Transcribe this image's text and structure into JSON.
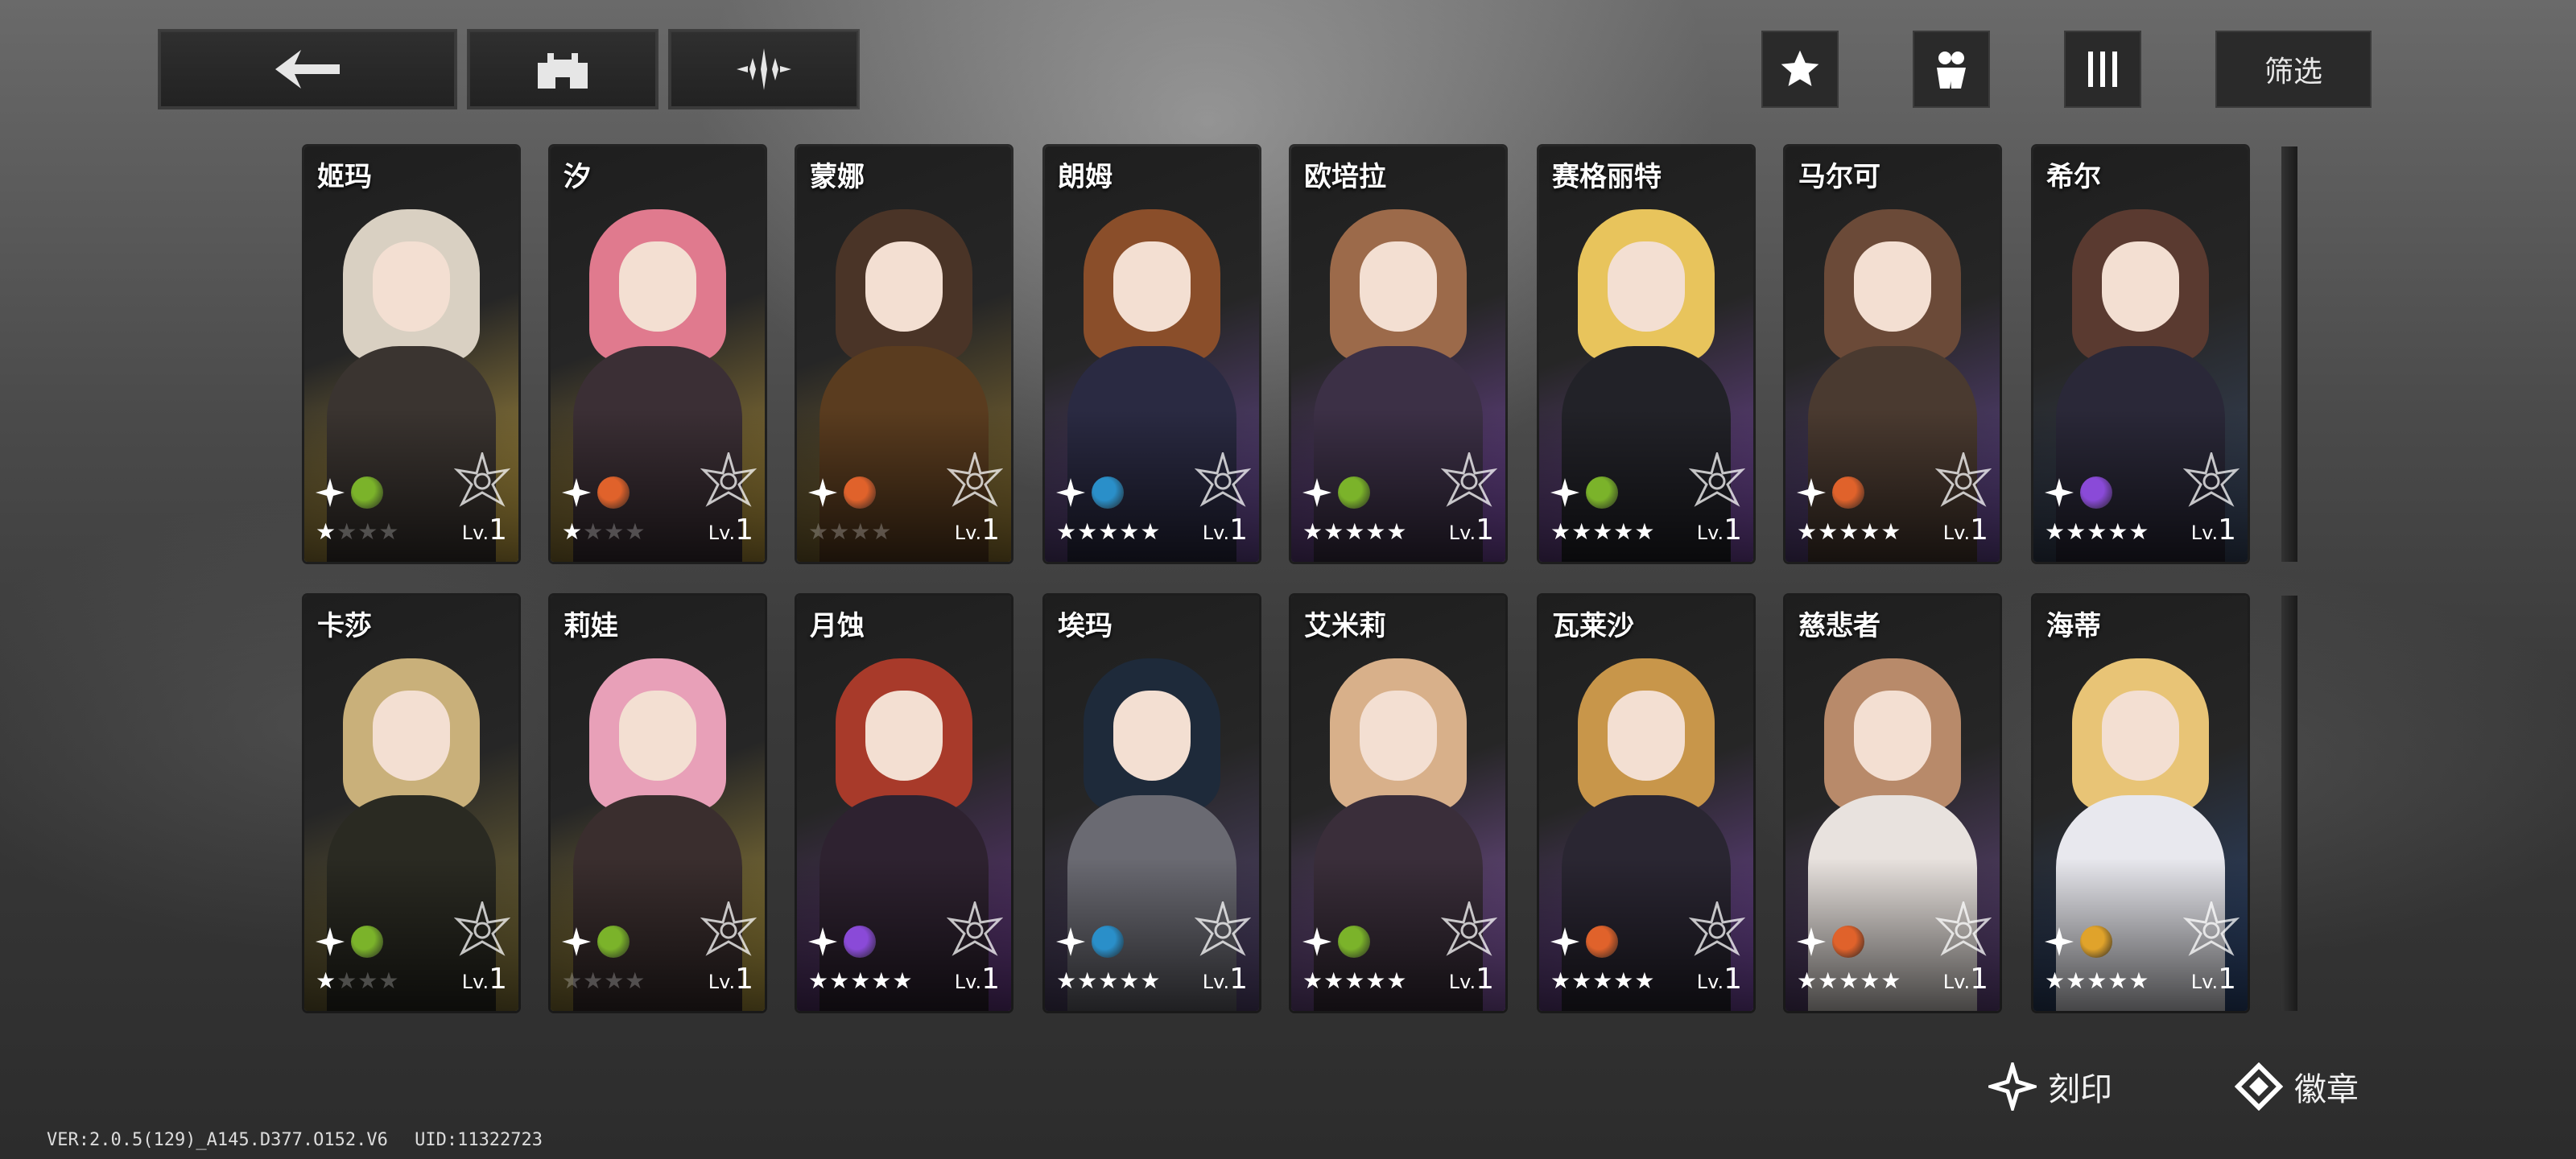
{
  "header": {
    "back_icon": "back-arrow-icon",
    "castle_icon": "castle-icon",
    "emblem_icon": "emblem-icon",
    "favorite_icon": "star-icon",
    "team_icon": "team-icon",
    "bars_icon": "bars-icon",
    "filter_label": "筛选"
  },
  "characters_row1": [
    {
      "name": "姬玛",
      "stars": "★",
      "stars_off": "★★★",
      "level_prefix": "Lv.",
      "level": "1",
      "element_color": "#7bb32a",
      "bg": "#c9a743",
      "hair": "#d9d0c2",
      "outfit": "#3a3430"
    },
    {
      "name": "汐",
      "stars": "★",
      "stars_off": "★★★",
      "level_prefix": "Lv.",
      "level": "1",
      "element_color": "#e0622b",
      "bg": "#b7963a",
      "hair": "#e07a8e",
      "outfit": "#3b2f35"
    },
    {
      "name": "蒙娜",
      "stars": "",
      "stars_off": "★★★★",
      "level_prefix": "Lv.",
      "level": "1",
      "element_color": "#e0622b",
      "bg": "#9a7d33",
      "hair": "#4a3427",
      "outfit": "#5a3c1f"
    },
    {
      "name": "朗姆",
      "stars": "★★★★★",
      "stars_off": "",
      "level_prefix": "Lv.",
      "level": "1",
      "element_color": "#2a8fc9",
      "bg": "#6a4a9a",
      "hair": "#8a4e2a",
      "outfit": "#2a2a42"
    },
    {
      "name": "欧培拉",
      "stars": "★★★★★",
      "stars_off": "",
      "level_prefix": "Lv.",
      "level": "1",
      "element_color": "#7bb32a",
      "bg": "#7a4aa8",
      "hair": "#9c6a4a",
      "outfit": "#3c3046"
    },
    {
      "name": "赛格丽特",
      "stars": "★★★★★",
      "stars_off": "",
      "level_prefix": "Lv.",
      "level": "1",
      "element_color": "#7bb32a",
      "bg": "#7a4aa8",
      "hair": "#e8c45c",
      "outfit": "#222228"
    },
    {
      "name": "马尔可",
      "stars": "★★★★★",
      "stars_off": "",
      "level_prefix": "Lv.",
      "level": "1",
      "element_color": "#e0622b",
      "bg": "#6a4a9a",
      "hair": "#6b4a38",
      "outfit": "#4a3a30"
    },
    {
      "name": "希尔",
      "stars": "★★★★★",
      "stars_off": "",
      "level_prefix": "Lv.",
      "level": "1",
      "element_color": "#8a4ad8",
      "bg": "#3a4a66",
      "hair": "#5a3a30",
      "outfit": "#2a2838"
    }
  ],
  "characters_row2": [
    {
      "name": "卡莎",
      "stars": "★",
      "stars_off": "★★★",
      "level_prefix": "Lv.",
      "level": "1",
      "element_color": "#7bb32a",
      "bg": "#8a7a3a",
      "hair": "#c9b07a",
      "outfit": "#2a2a22"
    },
    {
      "name": "莉娃",
      "stars": "",
      "stars_off": "★★★★",
      "level_prefix": "Lv.",
      "level": "1",
      "element_color": "#7bb32a",
      "bg": "#b39a3e",
      "hair": "#e8a0b8",
      "outfit": "#3a2e2e"
    },
    {
      "name": "月蚀",
      "stars": "★★★★★",
      "stars_off": "",
      "level_prefix": "Lv.",
      "level": "1",
      "element_color": "#8a4ad8",
      "bg": "#6a3a8a",
      "hair": "#a83a2a",
      "outfit": "#2e2230"
    },
    {
      "name": "埃玛",
      "stars": "★★★★★",
      "stars_off": "",
      "level_prefix": "Lv.",
      "level": "1",
      "element_color": "#2a8fc9",
      "bg": "#5a4a7a",
      "hair": "#1e2a3a",
      "outfit": "#6a6a72"
    },
    {
      "name": "艾米莉",
      "stars": "★★★★★",
      "stars_off": "",
      "level_prefix": "Lv.",
      "level": "1",
      "element_color": "#7bb32a",
      "bg": "#8a5ab0",
      "hair": "#d8b08a",
      "outfit": "#3a2e3a"
    },
    {
      "name": "瓦莱沙",
      "stars": "★★★★★",
      "stars_off": "",
      "level_prefix": "Lv.",
      "level": "1",
      "element_color": "#e0622b",
      "bg": "#7a4aa8",
      "hair": "#c8964a",
      "outfit": "#2a2632"
    },
    {
      "name": "慈悲者",
      "stars": "★★★★★",
      "stars_off": "",
      "level_prefix": "Lv.",
      "level": "1",
      "element_color": "#e0622b",
      "bg": "#6a4a8a",
      "hair": "#b88a6a",
      "outfit": "#e8e2de"
    },
    {
      "name": "海蒂",
      "stars": "★★★★★",
      "stars_off": "",
      "level_prefix": "Lv.",
      "level": "1",
      "element_color": "#e0a32b",
      "bg": "#2e4a7a",
      "hair": "#e8c476",
      "outfit": "#e8e8ee"
    }
  ],
  "bottom": {
    "engrave_label": "刻印",
    "badge_label": "徽章"
  },
  "footer": {
    "version": "VER:2.0.5(129)_A145.D377.O152.V6",
    "uid": "UID:11322723"
  }
}
